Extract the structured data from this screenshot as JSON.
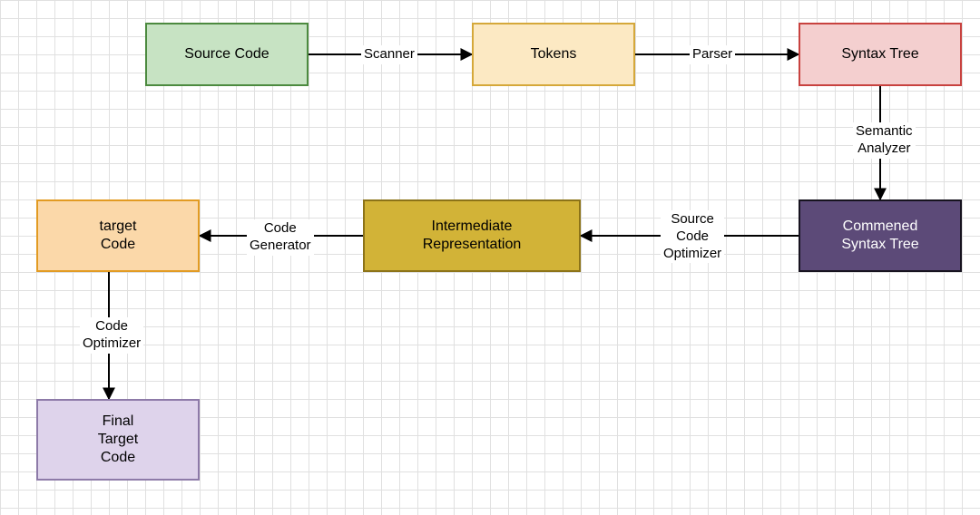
{
  "nodes": {
    "source_code": "Source Code",
    "tokens": "Tokens",
    "syntax_tree": "Syntax Tree",
    "commened_syntax_tree": "Commened\nSyntax Tree",
    "intermediate": "Intermediate\nRepresentation",
    "target_code": "target\nCode",
    "final_target_code": "Final\nTarget\nCode"
  },
  "edges": {
    "scanner": "Scanner",
    "parser": "Parser",
    "semantic_analyzer": "Semantic\nAnalyzer",
    "source_code_optimizer": "Source\nCode\nOptimizer",
    "code_generator": "Code\nGenerator",
    "code_optimizer": "Code\nOptimizer"
  }
}
